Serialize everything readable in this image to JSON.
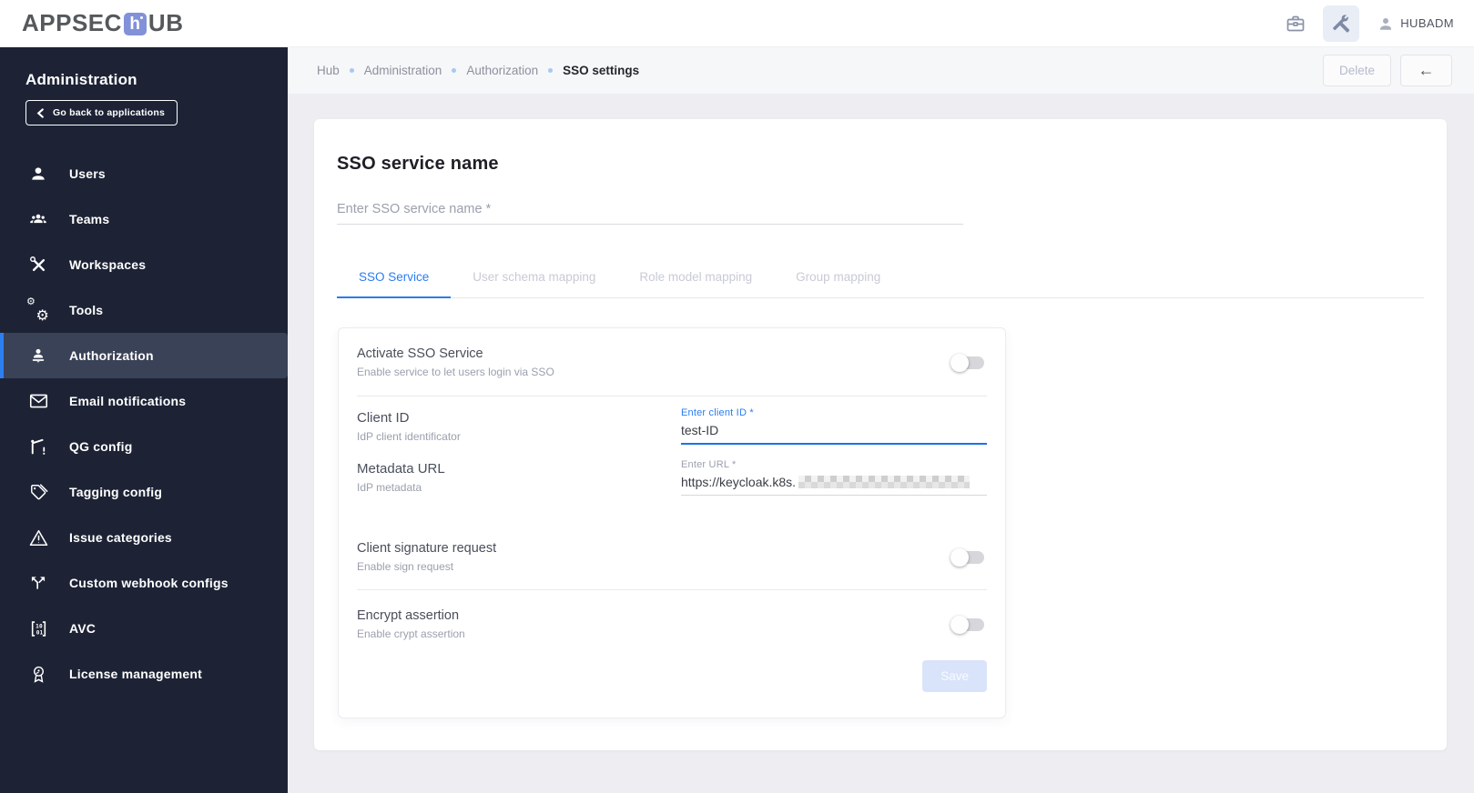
{
  "app": {
    "logo_part1": "APPSEC",
    "logo_mark": "h",
    "logo_part2": "UB",
    "username": "HUBADM"
  },
  "sidebar": {
    "title": "Administration",
    "back_button": "Go back to applications",
    "items": [
      {
        "label": "Users",
        "icon": "user-icon",
        "active": false
      },
      {
        "label": "Teams",
        "icon": "teams-icon",
        "active": false
      },
      {
        "label": "Workspaces",
        "icon": "hammer-wrench-icon",
        "active": false
      },
      {
        "label": "Tools",
        "icon": "gears-icon",
        "active": false
      },
      {
        "label": "Authorization",
        "icon": "person-podium-icon",
        "active": true
      },
      {
        "label": "Email notifications",
        "icon": "envelope-icon",
        "active": false
      },
      {
        "label": "QG config",
        "icon": "boom-gate-icon",
        "active": false
      },
      {
        "label": "Tagging config",
        "icon": "tag-icon",
        "active": false
      },
      {
        "label": "Issue categories",
        "icon": "warning-triangle-icon",
        "active": false
      },
      {
        "label": "Custom webhook configs",
        "icon": "split-arrows-icon",
        "active": false
      },
      {
        "label": "AVC",
        "icon": "binary-brackets-icon",
        "active": false
      },
      {
        "label": "License management",
        "icon": "award-icon",
        "active": false
      }
    ]
  },
  "breadcrumb": {
    "items": [
      "Hub",
      "Administration",
      "Authorization"
    ],
    "current": "SSO settings"
  },
  "page_actions": {
    "delete": "Delete",
    "back": "←"
  },
  "content": {
    "title": "SSO service name",
    "name_placeholder": "Enter SSO service name *",
    "tabs": [
      {
        "label": "SSO Service",
        "active": true
      },
      {
        "label": "User schema mapping",
        "active": false
      },
      {
        "label": "Role model mapping",
        "active": false
      },
      {
        "label": "Group mapping",
        "active": false
      }
    ],
    "form": {
      "activate": {
        "title": "Activate SSO Service",
        "subtitle": "Enable service to let users login via SSO",
        "enabled": false
      },
      "client_id": {
        "title": "Client ID",
        "subtitle": "IdP client identificator",
        "label": "Enter client ID *",
        "value": "test-ID"
      },
      "metadata_url": {
        "title": "Metadata URL",
        "subtitle": "IdP metadata",
        "label": "Enter URL *",
        "value": "https://keycloak.k8s.",
        "redacted": true
      },
      "signature": {
        "title": "Client signature request",
        "subtitle": "Enable sign request",
        "enabled": false
      },
      "encrypt": {
        "title": "Encrypt assertion",
        "subtitle": "Enable crypt assertion",
        "enabled": false
      },
      "save": "Save"
    }
  },
  "icons": {
    "gear": "⚙",
    "avc_top": "10",
    "avc_bottom": "01"
  },
  "colors": {
    "accent_blue": "#2a7cf0",
    "focused_underline": "#1a73e8",
    "sidebar_bg": "#1d2335",
    "sidebar_active_bg": "#3a4257",
    "active_bar": "#2d7ff0",
    "content_bg": "#ededf2",
    "breadcrumb_bg": "#f6f7f9",
    "save_button_bg": "#d9e4fb",
    "logo_mark_bg": "#8292d8"
  }
}
